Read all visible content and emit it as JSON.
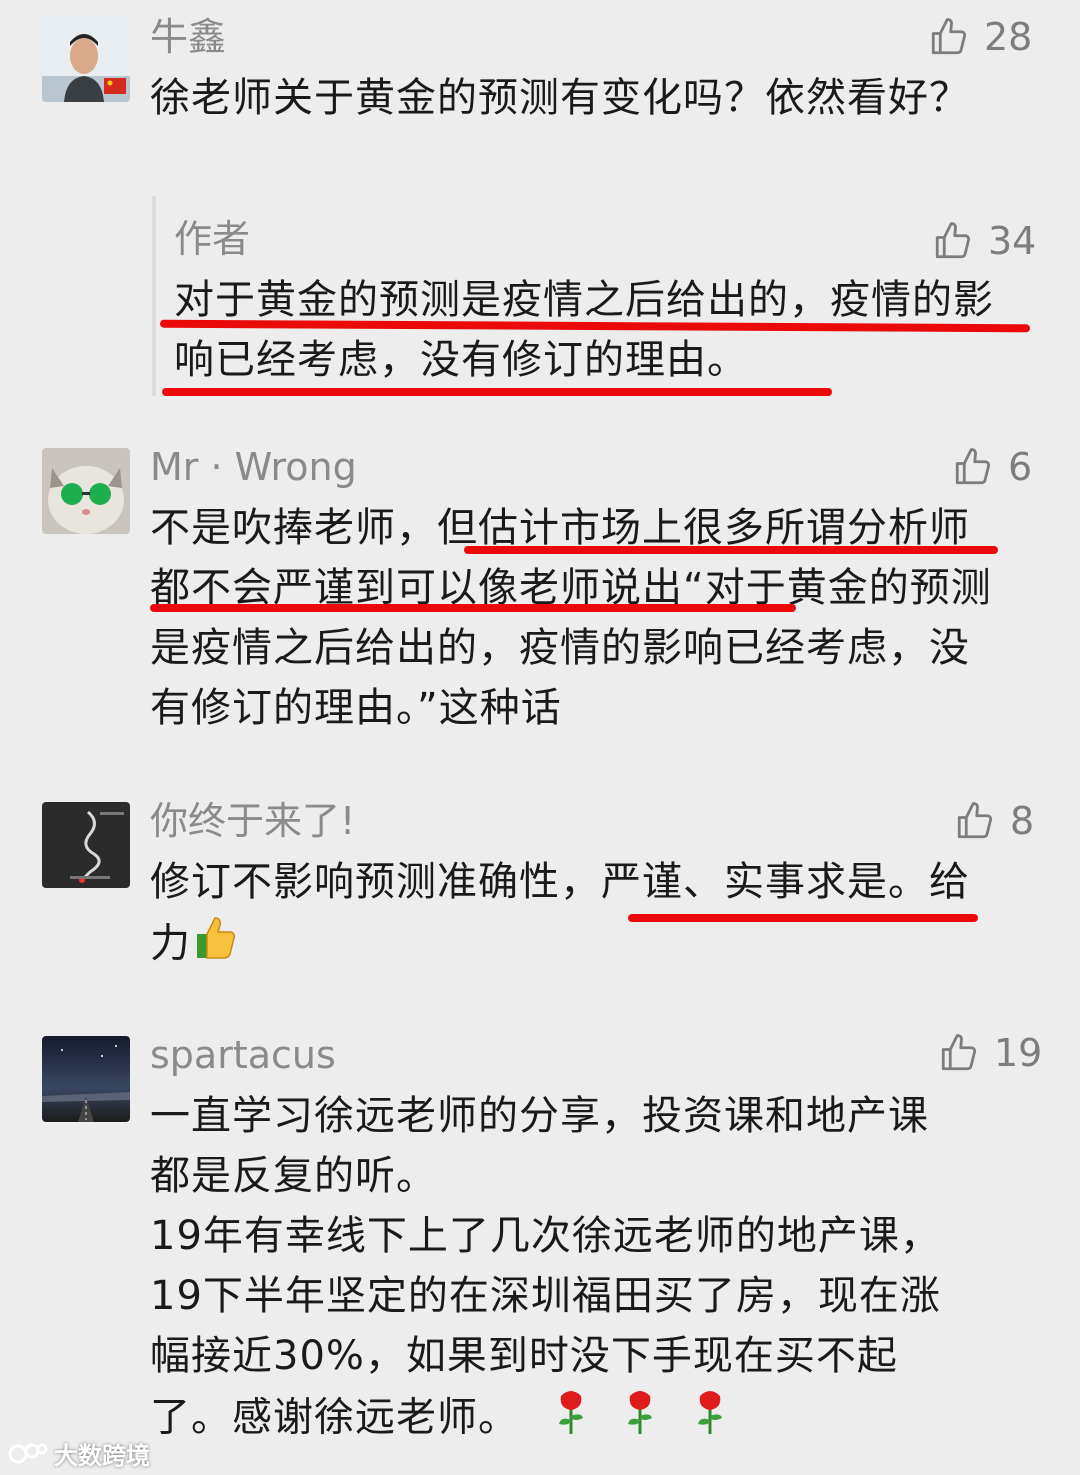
{
  "comments": [
    {
      "name": "牛鑫",
      "likes": "28",
      "text": "徐老师关于黄金的预测有变化吗？依然看好？",
      "reply": {
        "name": "作者",
        "likes": "34",
        "text": "对于黄金的预测是疫情之后给出的，疫情的影响已经考虑，没有修订的理由。"
      }
    },
    {
      "name": "Mr · Wrong",
      "likes": "6",
      "text": "不是吹捧老师，但估计市场上很多所谓分析师都不会严谨到可以像老师说出“对于黄金的预测是疫情之后给出的，疫情的影响已经考虑，没有修订的理由。”这种话"
    },
    {
      "name": "你终于来了!",
      "likes": "8",
      "text": "修订不影响预测准确性，严谨、实事求是。给力"
    },
    {
      "name": "spartacus",
      "likes": "19",
      "text_lines": [
        "一直学习徐远老师的分享，投资课和地产课",
        "都是反复的听。",
        "19年有幸线下上了几次徐远老师的地产课，",
        "19下半年坚定的在深圳福田买了房，现在涨",
        "幅接近30%，如果到时没下手现在买不起",
        "了。感谢徐远老师。"
      ]
    }
  ],
  "watermark": "大数跨境",
  "colors": {
    "underline": "#ea0a0a",
    "name": "#8a8a8a",
    "text": "#1a1a1a",
    "background": "#ededed"
  },
  "icons": [
    "thumbs-up-icon",
    "rose-icon",
    "thumbs-up-emoji"
  ]
}
